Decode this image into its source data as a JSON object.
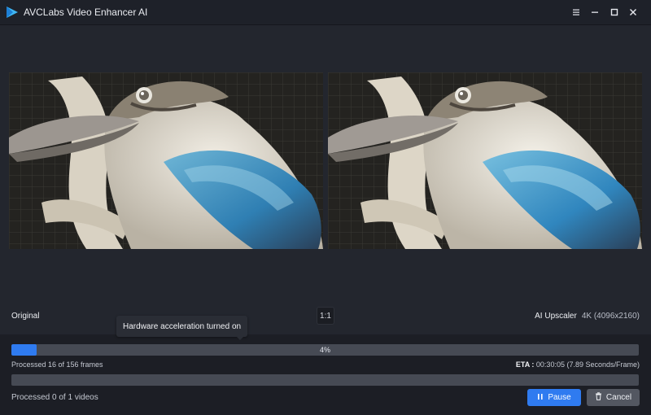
{
  "window": {
    "title": "AVCLabs Video Enhancer AI"
  },
  "preview": {
    "left_label": "Original",
    "ratio_label": "1:1",
    "right_label": "AI Upscaler",
    "resolution": "4K (4096x2160)"
  },
  "tooltip": {
    "text": "Hardware acceleration turned on"
  },
  "frame_progress": {
    "percent": 4,
    "percent_label": "4%",
    "processed_text": "Processed 16 of 156 frames",
    "eta_label": "ETA :",
    "eta_value": "00:30:05 (7.89 Seconds/Frame)"
  },
  "video_progress": {
    "percent": 0,
    "processed_text": "Processed 0 of 1 videos"
  },
  "buttons": {
    "pause_label": "Pause",
    "cancel_label": "Cancel"
  },
  "icons": {
    "app": "avclabs-logo-icon",
    "menu": "hamburger-menu-icon",
    "minimize": "minimize-icon",
    "maximize": "maximize-icon",
    "close": "close-icon",
    "pause": "pause-icon",
    "cancel": "trash-icon"
  },
  "colors": {
    "accent": "#2f7bf0",
    "background": "#1e2129",
    "track": "#464a54"
  }
}
